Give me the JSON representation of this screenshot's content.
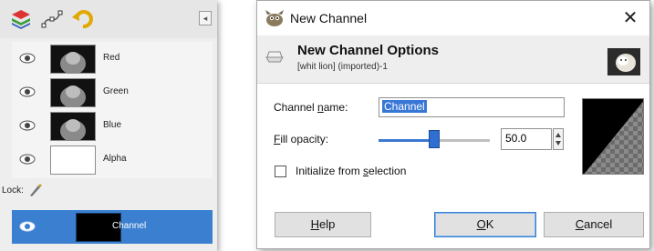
{
  "dock": {
    "tabs": [
      {
        "icon": "layers-icon"
      },
      {
        "icon": "paths-icon"
      },
      {
        "icon": "undo-history-icon"
      }
    ],
    "channels": [
      {
        "name": "Red",
        "icon": "eye-icon"
      },
      {
        "name": "Green",
        "icon": "eye-icon"
      },
      {
        "name": "Blue",
        "icon": "eye-icon"
      },
      {
        "name": "Alpha",
        "icon": "eye-icon"
      }
    ],
    "lock_label": "Lock:",
    "active_channel": {
      "name": "Channel",
      "icon": "eye-icon"
    }
  },
  "dialog": {
    "title": "New Channel",
    "close_glyph": "✕",
    "header_title": "New Channel Options",
    "header_subtitle": "[whit lion] (imported)-1",
    "name_label": {
      "pre": "Channel ",
      "key": "n",
      "post": "ame:"
    },
    "name_value": "Channel",
    "opacity_label": {
      "pre": "",
      "key": "F",
      "post": "ill opacity:"
    },
    "opacity_value": "50.0",
    "opacity_percent": 50,
    "checkbox_label": {
      "pre": "Initialize from ",
      "key": "s",
      "post": "election"
    },
    "checkbox_checked": false,
    "buttons": {
      "help": {
        "pre": "",
        "key": "H",
        "post": "elp"
      },
      "ok": {
        "pre": "",
        "key": "O",
        "post": "K"
      },
      "cancel": {
        "pre": "",
        "key": "C",
        "post": "ancel"
      }
    },
    "colors": {
      "accent": "#3b78d1",
      "selection": "#3877d6"
    }
  }
}
